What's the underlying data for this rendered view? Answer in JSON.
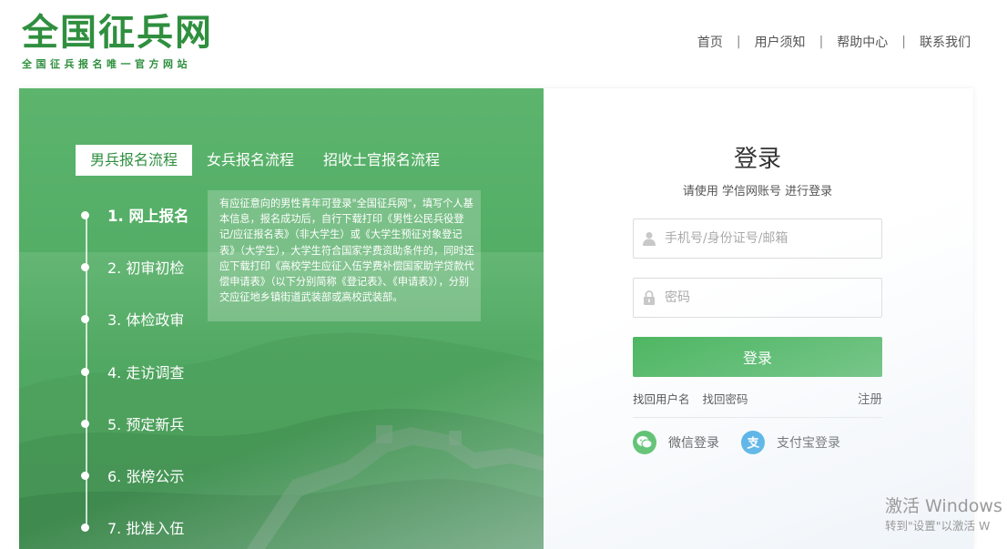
{
  "header": {
    "logo_title": "全国征兵网",
    "logo_subtitle": "全国征兵报名唯一官方网站",
    "nav": [
      "首页",
      "用户须知",
      "帮助中心",
      "联系我们"
    ],
    "separator": "|"
  },
  "process": {
    "tabs": [
      "男兵报名流程",
      "女兵报名流程",
      "招收士官报名流程"
    ],
    "active_tab": 0,
    "steps": [
      "1. 网上报名",
      "2. 初审初检",
      "3. 体检政审",
      "4. 走访调查",
      "5. 预定新兵",
      "6. 张榜公示",
      "7. 批准入伍"
    ],
    "active_step": 0,
    "description": "有应征意向的男性青年可登录\"全国征兵网\"，填写个人基本信息，报名成功后，自行下载打印《男性公民兵役登记/应征报名表》（非大学生）或《大学生预征对象登记表》（大学生），大学生符合国家学费资助条件的，同时还应下载打印《高校学生应征入伍学费补偿国家助学贷款代偿申请表》（以下分别简称《登记表》、《申请表》），分别交应征地乡镇街道武装部或高校武装部。"
  },
  "login": {
    "title": "登录",
    "subtitle": "请使用 学信网账号 进行登录",
    "username_placeholder": "手机号/身份证号/邮箱",
    "password_placeholder": "密码",
    "login_button": "登录",
    "find_username": "找回用户名",
    "find_password": "找回密码",
    "register": "注册",
    "wechat_login": "微信登录",
    "alipay_login": "支付宝登录"
  },
  "watermark": {
    "line1": "激活 Windows",
    "line2": "转到\"设置\"以激活 W"
  },
  "colors": {
    "brand_green": "#2f8f3f",
    "panel_green": "#52ac64",
    "button_green": "#45b35a",
    "wechat_green": "#35b34a",
    "alipay_blue": "#1b9ae0"
  },
  "icons": [
    "user-icon",
    "lock-icon",
    "wechat-icon",
    "alipay-icon"
  ]
}
